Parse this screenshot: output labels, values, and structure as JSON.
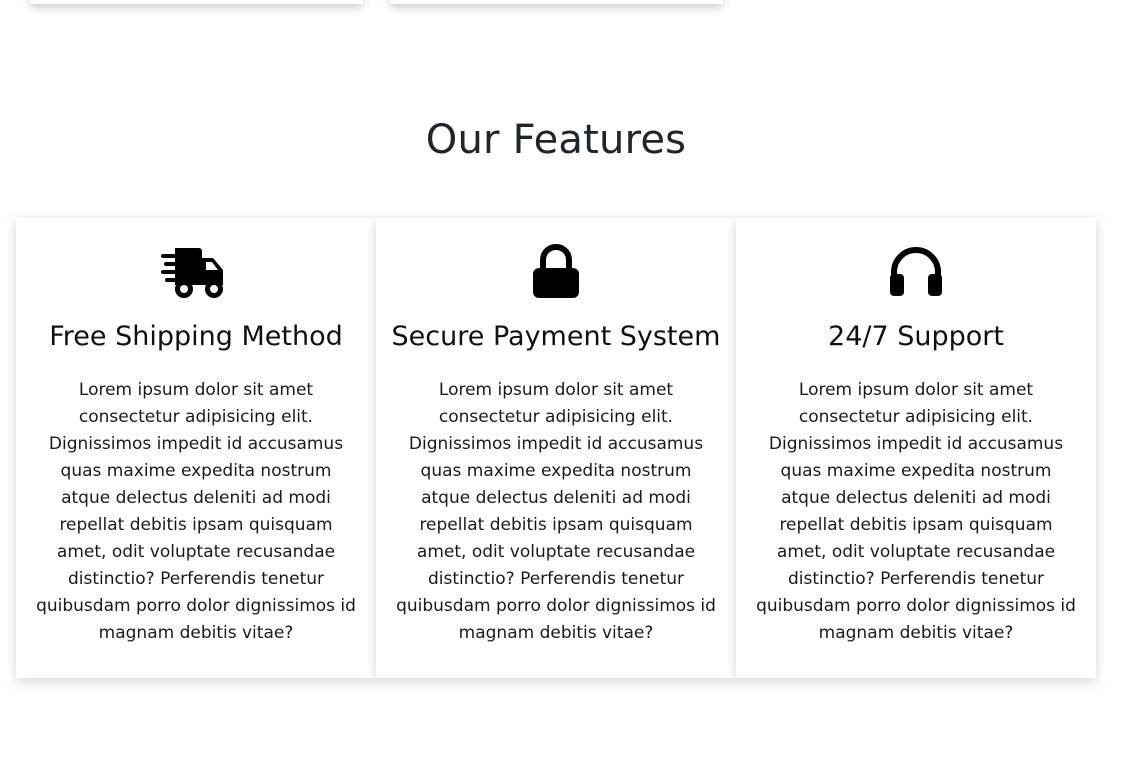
{
  "section": {
    "title": "Our Features"
  },
  "features": [
    {
      "icon": "shipping-truck-icon",
      "title": "Free Shipping Method",
      "description": "Lorem ipsum dolor sit amet consectetur adipisicing elit. Dignissimos impedit id accusamus quas maxime expedita nostrum atque delectus deleniti ad modi repellat debitis ipsam quisquam amet, odit voluptate recusandae distinctio? Perferendis tenetur quibusdam porro dolor dignissimos id magnam debitis vitae?"
    },
    {
      "icon": "lock-icon",
      "title": "Secure Payment System",
      "description": "Lorem ipsum dolor sit amet consectetur adipisicing elit. Dignissimos impedit id accusamus quas maxime expedita nostrum atque delectus deleniti ad modi repellat debitis ipsam quisquam amet, odit voluptate recusandae distinctio? Perferendis tenetur quibusdam porro dolor dignissimos id magnam debitis vitae?"
    },
    {
      "icon": "headphones-icon",
      "title": "24/7 Support",
      "description": "Lorem ipsum dolor sit amet consectetur adipisicing elit. Dignissimos impedit id accusamus quas maxime expedita nostrum atque delectus deleniti ad modi repellat debitis ipsam quisquam amet, odit voluptate recusandae distinctio? Perferendis tenetur quibusdam porro dolor dignissimos id magnam debitis vitae?"
    }
  ]
}
